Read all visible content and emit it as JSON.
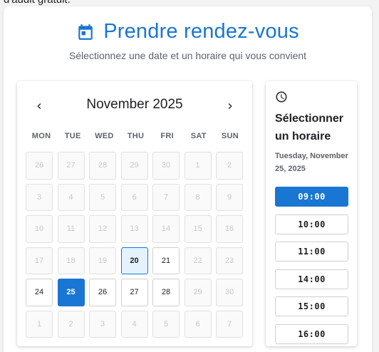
{
  "top_text": "d'audit gratuit.",
  "header": {
    "title": "Prendre rendez-vous",
    "subtitle": "Sélectionnez une date et un horaire qui vous convient",
    "accent_color": "#1976d2"
  },
  "calendar": {
    "month_label": "November 2025",
    "prev_icon": "chevron-left-icon",
    "next_icon": "chevron-right-icon",
    "weekdays": [
      "MON",
      "TUE",
      "WED",
      "THU",
      "FRI",
      "SAT",
      "SUN"
    ],
    "days": [
      {
        "label": "26",
        "state": "disabled"
      },
      {
        "label": "27",
        "state": "disabled"
      },
      {
        "label": "28",
        "state": "disabled"
      },
      {
        "label": "29",
        "state": "disabled"
      },
      {
        "label": "30",
        "state": "disabled"
      },
      {
        "label": "1",
        "state": "disabled"
      },
      {
        "label": "2",
        "state": "disabled"
      },
      {
        "label": "3",
        "state": "disabled"
      },
      {
        "label": "4",
        "state": "disabled"
      },
      {
        "label": "5",
        "state": "disabled"
      },
      {
        "label": "6",
        "state": "disabled"
      },
      {
        "label": "7",
        "state": "disabled"
      },
      {
        "label": "8",
        "state": "disabled"
      },
      {
        "label": "9",
        "state": "disabled"
      },
      {
        "label": "10",
        "state": "disabled"
      },
      {
        "label": "11",
        "state": "disabled"
      },
      {
        "label": "12",
        "state": "disabled"
      },
      {
        "label": "13",
        "state": "disabled"
      },
      {
        "label": "14",
        "state": "disabled"
      },
      {
        "label": "15",
        "state": "disabled"
      },
      {
        "label": "16",
        "state": "disabled"
      },
      {
        "label": "17",
        "state": "disabled"
      },
      {
        "label": "18",
        "state": "disabled"
      },
      {
        "label": "19",
        "state": "disabled"
      },
      {
        "label": "20",
        "state": "today"
      },
      {
        "label": "21",
        "state": "available"
      },
      {
        "label": "22",
        "state": "disabled"
      },
      {
        "label": "23",
        "state": "disabled"
      },
      {
        "label": "24",
        "state": "available"
      },
      {
        "label": "25",
        "state": "selected"
      },
      {
        "label": "26",
        "state": "available"
      },
      {
        "label": "27",
        "state": "available"
      },
      {
        "label": "28",
        "state": "available"
      },
      {
        "label": "29",
        "state": "disabled"
      },
      {
        "label": "30",
        "state": "disabled"
      },
      {
        "label": "1",
        "state": "disabled"
      },
      {
        "label": "2",
        "state": "disabled"
      },
      {
        "label": "3",
        "state": "disabled"
      },
      {
        "label": "4",
        "state": "disabled"
      },
      {
        "label": "5",
        "state": "disabled"
      },
      {
        "label": "6",
        "state": "disabled"
      },
      {
        "label": "7",
        "state": "disabled"
      }
    ]
  },
  "slots": {
    "icon": "clock-icon",
    "title": "Sélectionner un horaire",
    "selected_date": "Tuesday, November 25, 2025",
    "times": [
      {
        "label": "09:00",
        "active": true
      },
      {
        "label": "10:00",
        "active": false
      },
      {
        "label": "11:00",
        "active": false
      },
      {
        "label": "14:00",
        "active": false
      },
      {
        "label": "15:00",
        "active": false
      },
      {
        "label": "16:00",
        "active": false
      }
    ]
  }
}
